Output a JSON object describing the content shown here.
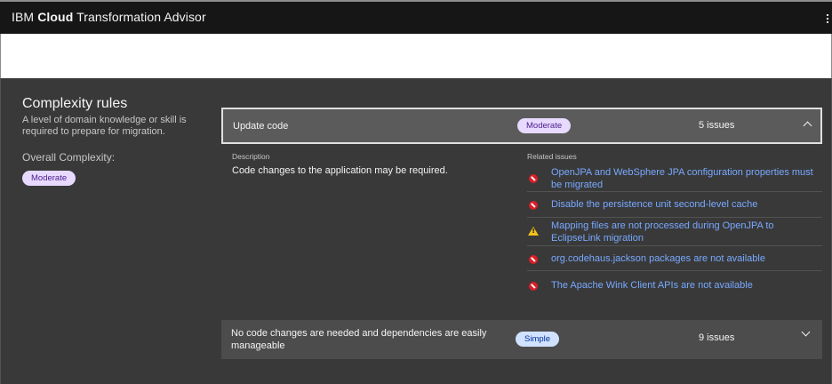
{
  "header": {
    "brand_prefix": "IBM ",
    "brand_bold": "Cloud",
    "brand_suffix": " Transformation Advisor",
    "menu_icon": "overflow-menu-vertical-icon"
  },
  "sidebar": {
    "title": "Complexity rules",
    "description": "A level of domain knowledge or skill is required to prepare for migration.",
    "overall_label": "Overall Complexity:",
    "overall_value": "Moderate"
  },
  "accordions": [
    {
      "title": "Update code",
      "tag": "Moderate",
      "tag_color": "#e8daff",
      "count": "5 issues",
      "expanded": true,
      "description_label": "Description",
      "description": "Code changes to the application may be required.",
      "related_label": "Related issues",
      "issues": [
        {
          "severity": "error",
          "icon": "error-filled-icon",
          "text": "OpenJPA and WebSphere JPA configuration properties must be migrated"
        },
        {
          "severity": "error",
          "icon": "error-filled-icon",
          "text": "Disable the persistence unit second-level cache"
        },
        {
          "severity": "warning",
          "icon": "warning-triangle-icon",
          "text": "Mapping files are not processed during OpenJPA to EclipseLink migration"
        },
        {
          "severity": "error",
          "icon": "error-filled-icon",
          "text": "org.codehaus.jackson packages are not available"
        },
        {
          "severity": "error",
          "icon": "error-filled-icon",
          "text": "The Apache Wink Client APIs are not available"
        }
      ]
    },
    {
      "title": "No code changes are needed and dependencies are easily manageable",
      "tag": "Simple",
      "tag_color": "#d0e2ff",
      "count": "9 issues",
      "expanded": false
    }
  ],
  "colors": {
    "error": "#da1e28",
    "warning": "#f1c21b",
    "link": "#78a9ff"
  }
}
